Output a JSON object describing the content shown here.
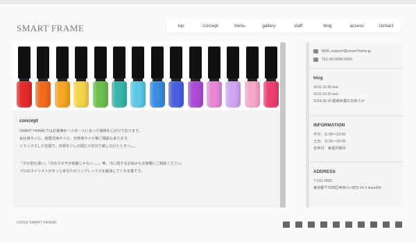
{
  "header": {
    "logo": "SMART FRAME",
    "nav": [
      "top",
      "concept",
      "menu",
      "gallery",
      "staff",
      "blog",
      "access",
      "contact"
    ]
  },
  "hero": {
    "bottle_colors": [
      "#e52a2a",
      "#f26a1e",
      "#f5a623",
      "#f7d34a",
      "#6fbf4e",
      "#38b7a8",
      "#5cc8e6",
      "#3a8de0",
      "#4c5fe0",
      "#a84cd8",
      "#e888d8",
      "#cfa8f2",
      "#f7a8c8",
      "#ee3f6f"
    ]
  },
  "main": {
    "title": "concept",
    "lines": [
      "SMART FRAMEではお客様お一人お一人に合った施術を心がけております。",
      "会社用ネイル、結婚式用ネイル、日常用ネイル等ご相談も承ります。",
      "リラックスした空間で、日常を少しの間だけ忘れて癒しのひとときへ。。。",
      "",
      "「爪が割れ易い」「爪のカタチが奇麗じゃない。。。」等、爪に関するお悩みもお気軽にご相談ください。",
      "プロのネイリストがきっとあなたのコンプレックスを解消してくれる筈です。"
    ]
  },
  "sidebar": {
    "mail": "MAIL:support@smart-frame.jp",
    "tel": "TEL:00-0000-0000",
    "blog": {
      "title": "blog",
      "items": [
        "2015.10.26 test",
        "2015.10.20 test",
        "2014.06.16 臨時休業のお知らせ"
      ]
    },
    "info": {
      "title": "INFORMATION",
      "items": [
        "平日：11:00〜22:00",
        "土日：11:00〜20:00",
        "定休日：毎週月曜日"
      ]
    },
    "address": {
      "title": "ADDRESS",
      "items": [
        "〒101-0052",
        "東京都千代田区神田小川町3-14-3 ilusa406"
      ]
    }
  },
  "footer": {
    "copyright": "©2018 SMART FRAME.",
    "social": [
      "facebook-icon",
      "twitter-icon",
      "google-plus-icon",
      "pinterest-icon",
      "flickr-icon",
      "tumblr-icon",
      "instagram-icon",
      "linkedin-icon",
      "vimeo-icon",
      "youtube-icon"
    ]
  }
}
